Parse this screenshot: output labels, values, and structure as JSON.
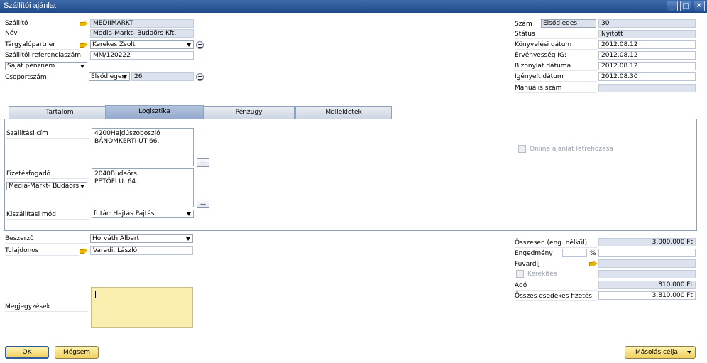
{
  "window": {
    "title": "Szállítói ajánlat"
  },
  "header_left": {
    "vendor_label": "Szállító",
    "vendor_value": "MEDIIMARKT",
    "name_label": "Név",
    "name_value": "Media-Markt- Budaörs Kft.",
    "contact_label": "Tárgyalópartner",
    "contact_value": "Kerekes Zsolt",
    "vendor_ref_label": "Szállítói referenciaszám",
    "vendor_ref_value": "MM/120222",
    "currency_value": "Saját pénznem",
    "group_label": "Csoportszám",
    "group_type": "Elsődleges",
    "group_value": "26"
  },
  "header_right": {
    "number_label": "Szám",
    "number_series": "Elsődleges",
    "number_value": "30",
    "status_label": "Státus",
    "status_value": "Nyitott",
    "posting_date_label": "Könyvelési dátum",
    "posting_date_value": "2012.08.12",
    "valid_until_label": "Érvényesség IG:",
    "valid_until_value": "2012.08.12",
    "document_date_label": "Bizonylat dátuma",
    "document_date_value": "2012.08.12",
    "required_date_label": "Igényelt dátum",
    "required_date_value": "2012.08.30",
    "manual_number_label": "Manuális szám",
    "manual_number_value": ""
  },
  "tabs": [
    "Tartalom",
    "Logisztika",
    "Pénzügy",
    "Mellékletek"
  ],
  "logistics": {
    "ship_to_label": "Szállítási cím",
    "ship_to_line1": "4200Hajdúszoboszló",
    "ship_to_line2": "BÁNOMKERTI ÚT 66.",
    "pay_to_label": "Fizetésfogadó",
    "pay_to_select": "Media-Markt- Budaörs",
    "pay_to_line1": "2040Budaörs",
    "pay_to_line2": "PETŐFI U. 64.",
    "shipping_method_label": "Kiszállítási mód",
    "shipping_method_value": "futár: Hajtás Pajtás",
    "online_quote_label": "Online ajánlat létrehozása",
    "dots": "..."
  },
  "footer_left": {
    "buyer_label": "Beszerző",
    "buyer_value": "Horváth Albert",
    "owner_label": "Tulajdonos",
    "owner_value": "Váradi, László",
    "remarks_label": "Megjegyzések",
    "remarks_value": ""
  },
  "totals": {
    "total_before_discount_label": "Összesen (eng. nélkül)",
    "total_before_discount_value": "3.000.000 Ft",
    "discount_label": "Engedmény",
    "discount_percent": "",
    "percent_sign": "%",
    "discount_value": "",
    "freight_label": "Fuvardíj",
    "freight_value": "",
    "rounding_label": "Kerekítés",
    "rounding_value": "",
    "tax_label": "Adó",
    "tax_value": "810.000 Ft",
    "total_due_label": "Összes esedékes fizetés",
    "total_due_value": "3.810.000 Ft"
  },
  "buttons": {
    "ok": "OK",
    "cancel": "Mégsem",
    "copy_to": "Másolás célja"
  },
  "window_controls": {
    "minimize": "_",
    "maximize": "□",
    "close": "✕"
  }
}
